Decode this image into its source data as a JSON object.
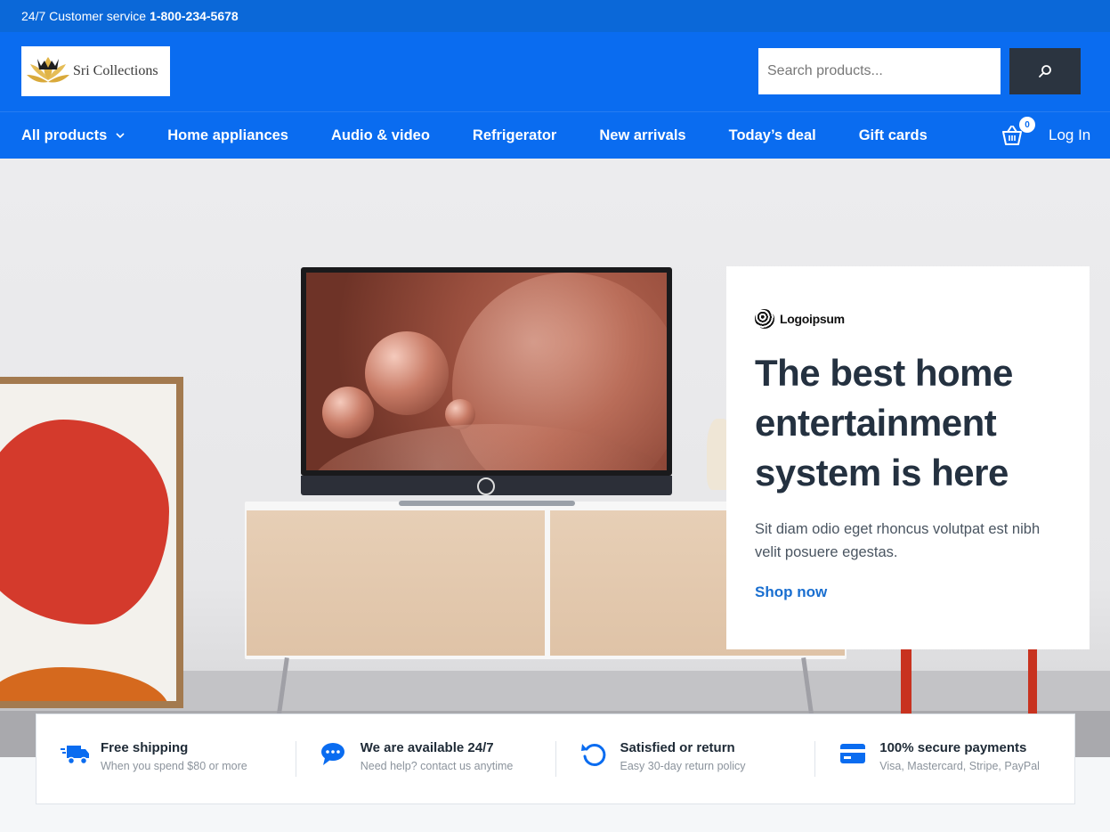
{
  "topbar": {
    "service_label": "24/7 Customer service",
    "phone": "1-800-234-5678"
  },
  "header": {
    "logo_text": "Sri Collections",
    "search_placeholder": "Search products..."
  },
  "nav": {
    "items": [
      "All products",
      "Home appliances",
      "Audio & video",
      "Refrigerator",
      "New arrivals",
      "Today’s deal",
      "Gift cards"
    ],
    "cart_count": "0",
    "login_label": "Log In"
  },
  "hero": {
    "brand_name": "Logoipsum",
    "headline": "The best home entertainment system is here",
    "description": "Sit diam odio eget rhoncus volutpat est nibh velit posuere egestas.",
    "cta": "Shop now"
  },
  "features": [
    {
      "icon": "truck-icon",
      "title": "Free shipping",
      "subtitle": "When you spend $80 or more"
    },
    {
      "icon": "chat-icon",
      "title": "We are available 24/7",
      "subtitle": "Need help? contact us anytime"
    },
    {
      "icon": "return-icon",
      "title": "Satisfied or return",
      "subtitle": "Easy 30-day return policy"
    },
    {
      "icon": "credit-card-icon",
      "title": "100% secure payments",
      "subtitle": "Visa, Mastercard, Stripe, PayPal"
    }
  ],
  "colors": {
    "primary": "#0a6cf0",
    "topbar": "#0b68d8",
    "dark": "#2b3440",
    "accent_link": "#1a6fd0"
  }
}
